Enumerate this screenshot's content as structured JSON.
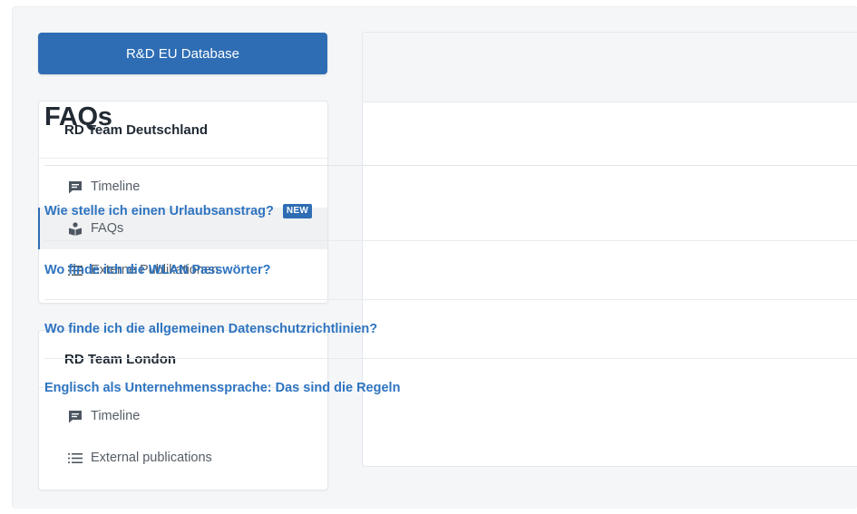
{
  "header": {
    "db_button_label": "R&D EU Database"
  },
  "sidebar": {
    "teams": [
      {
        "title": "RD Team Deutschland",
        "items": [
          {
            "label": "Timeline",
            "icon": "chat-icon",
            "active": false
          },
          {
            "label": "FAQs",
            "icon": "reader-icon",
            "active": true
          },
          {
            "label": "Externe Publikationen",
            "icon": "list-icon",
            "active": false
          }
        ]
      },
      {
        "title": "RD Team London",
        "items": [
          {
            "label": "Timeline",
            "icon": "chat-icon",
            "active": false
          },
          {
            "label": "External publications",
            "icon": "list-icon",
            "active": false
          }
        ]
      }
    ]
  },
  "main": {
    "title": "FAQs",
    "faqs": [
      {
        "question": "Wie stelle ich einen Urlaubsanstrag?",
        "badge": "NEW"
      },
      {
        "question": "Wo finde ich die WLAN Passwörter?"
      },
      {
        "question": "Wo finde ich die allgemeinen Datenschutzrichtlinien?"
      },
      {
        "question": "Englisch als Unternehmenssprache: Das sind die Regeln"
      }
    ]
  },
  "colors": {
    "accent": "#2e6db4",
    "link": "#2e74c0",
    "background": "#f5f6f8"
  }
}
